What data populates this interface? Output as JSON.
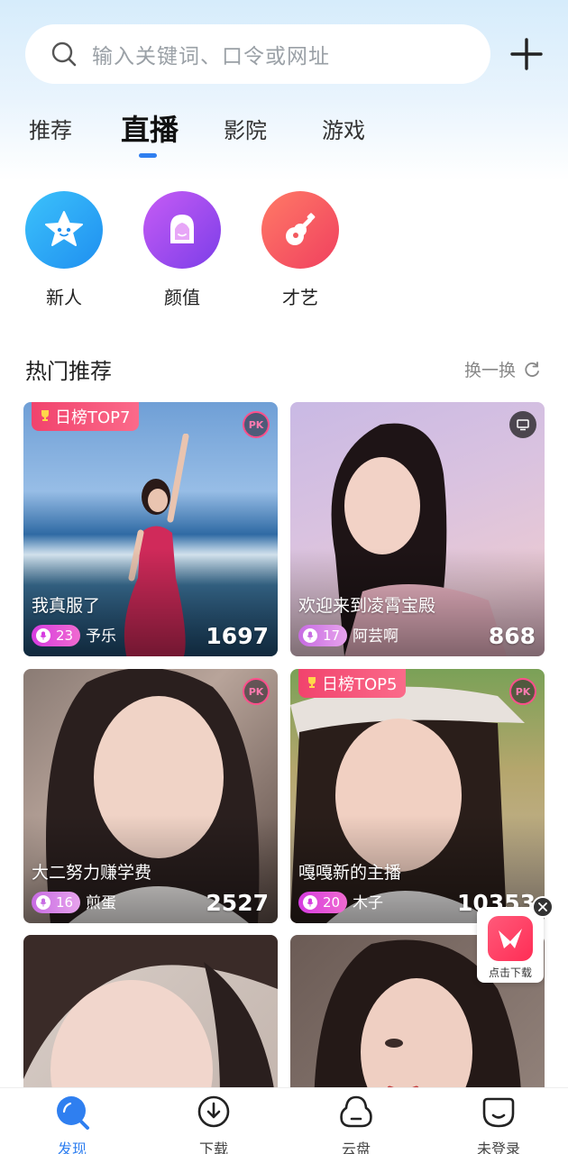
{
  "search": {
    "placeholder": "输入关键词、口令或网址"
  },
  "tabs": [
    {
      "label": "推荐",
      "active": false
    },
    {
      "label": "直播",
      "active": true
    },
    {
      "label": "影院",
      "active": false
    },
    {
      "label": "游戏",
      "active": false
    }
  ],
  "categories": [
    {
      "label": "新人",
      "icon": "star-face-icon",
      "color": "#2aa6f5"
    },
    {
      "label": "颜值",
      "icon": "girl-face-icon",
      "color": "#a54ff0"
    },
    {
      "label": "才艺",
      "icon": "guitar-icon",
      "color": "#f5505e"
    }
  ],
  "section": {
    "title": "热门推荐",
    "refresh_label": "换一换"
  },
  "cards": [
    {
      "title": "我真服了",
      "level": "23",
      "anchor": "予乐",
      "viewers": "1697",
      "rank": "日榜TOP7",
      "badge": "PK"
    },
    {
      "title": "欢迎来到凌霄宝殿",
      "level": "17",
      "anchor": "阿芸啊",
      "viewers": "868",
      "rank": "",
      "badge": "screen"
    },
    {
      "title": "大二努力赚学费",
      "level": "16",
      "anchor": "煎蛋",
      "viewers": "2527",
      "rank": "",
      "badge": "PK"
    },
    {
      "title": "嘎嘎新的主播",
      "level": "20",
      "anchor": "木子",
      "viewers": "10353",
      "rank": "日榜TOP5",
      "badge": "PK"
    },
    {
      "title": "",
      "level": "",
      "anchor": "",
      "viewers": "",
      "rank": "",
      "badge": ""
    },
    {
      "title": "",
      "level": "",
      "anchor": "",
      "viewers": "",
      "rank": "",
      "badge": ""
    }
  ],
  "float_ad": {
    "label": "点击下载"
  },
  "bottom_nav": [
    {
      "label": "发现",
      "icon": "discover-icon",
      "active": true
    },
    {
      "label": "下载",
      "icon": "download-icon",
      "active": false
    },
    {
      "label": "云盘",
      "icon": "cloud-icon",
      "active": false
    },
    {
      "label": "未登录",
      "icon": "user-icon",
      "active": false
    }
  ],
  "colors": {
    "accent": "#2f7ff0",
    "rank_badge": "#f1436d",
    "level_badge": "#d63be0"
  }
}
